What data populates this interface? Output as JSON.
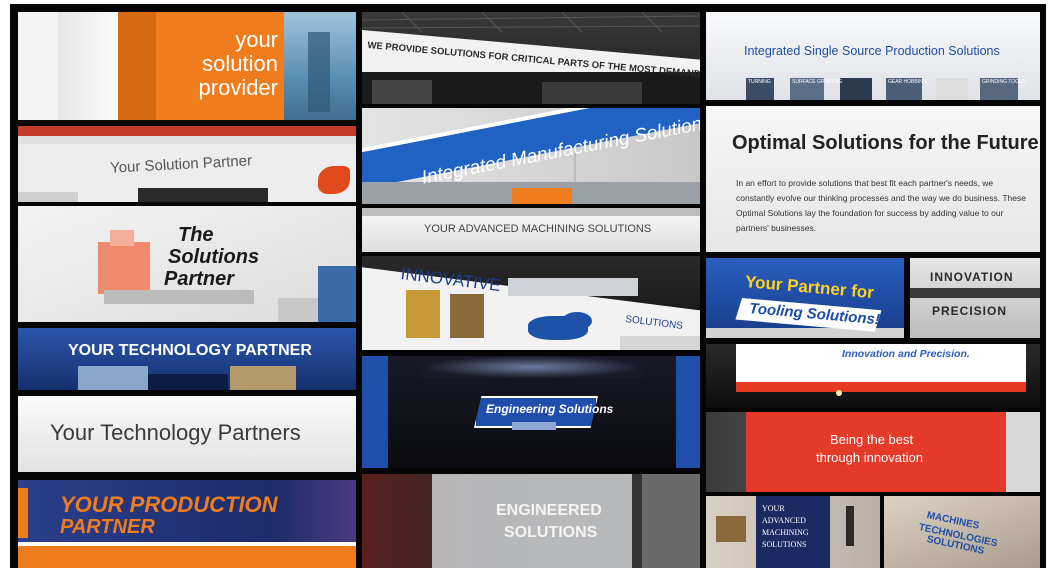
{
  "tiles": {
    "t1": {
      "text": "your\nsolution\nprovider"
    },
    "t2": {
      "text": "WE PROVIDE SOLUTIONS FOR CRITICAL PARTS OF THE MOST DEMANDING SECTORS"
    },
    "t3": {
      "title": "Integrated Single Source Production Solutions",
      "thumbs": [
        "TURNING",
        "SURFACE GRINDING",
        "",
        "GEAR HOBBING",
        "GRINDING TOOLS"
      ]
    },
    "t4": {
      "text": "Your Solution Partner"
    },
    "t5": {
      "text": "Integrated Manufacturing Solutions"
    },
    "t6": {
      "title": "Optimal Solutions for the Future",
      "body": "In an effort to provide solutions that best fit each partner's needs, we constantly evolve our thinking processes and the way we do business. These Optimal Solutions lay the foundation for success by adding value to our partners' businesses."
    },
    "t7": {
      "line1": "The",
      "line2": "Solutions",
      "line3": "Partner"
    },
    "t8": {
      "text": "YOUR ADVANCED MACHINING SOLUTIONS"
    },
    "t9": {
      "line1": "Your Partner for",
      "line2": "Tooling Solutions!"
    },
    "t10": {
      "line1": "INNOVATION",
      "line2": "PRECISION"
    },
    "t11": {
      "line1": "INNOVATIVE",
      "line2": "SOLUTIONS"
    },
    "t12": {
      "text": "YOUR TECHNOLOGY PARTNER"
    },
    "t13": {
      "text": "Innovation and Precision."
    },
    "t14": {
      "text": "Engineering Solutions"
    },
    "t15": {
      "text": "Your Technology Partners"
    },
    "t16": {
      "line1": "Being the best",
      "line2": "through innovation"
    },
    "t17": {
      "line1": "YOUR PRODUCTION",
      "line2": "PARTNER"
    },
    "t18": {
      "line1": "ENGINEERED",
      "line2": "SOLUTIONS"
    },
    "t19": {
      "line1": "YOUR",
      "line2": "ADVANCED",
      "line3": "MACHINING",
      "line4": "SOLUTIONS"
    },
    "t20": {
      "line1": "MACHINES",
      "line2": "TECHNOLOGIES",
      "line3": "SOLUTIONS"
    }
  },
  "colors": {
    "orange": "#ef7d1d",
    "blue": "#1d4fa8",
    "red": "#e5392a",
    "navy": "#1b2a63"
  }
}
